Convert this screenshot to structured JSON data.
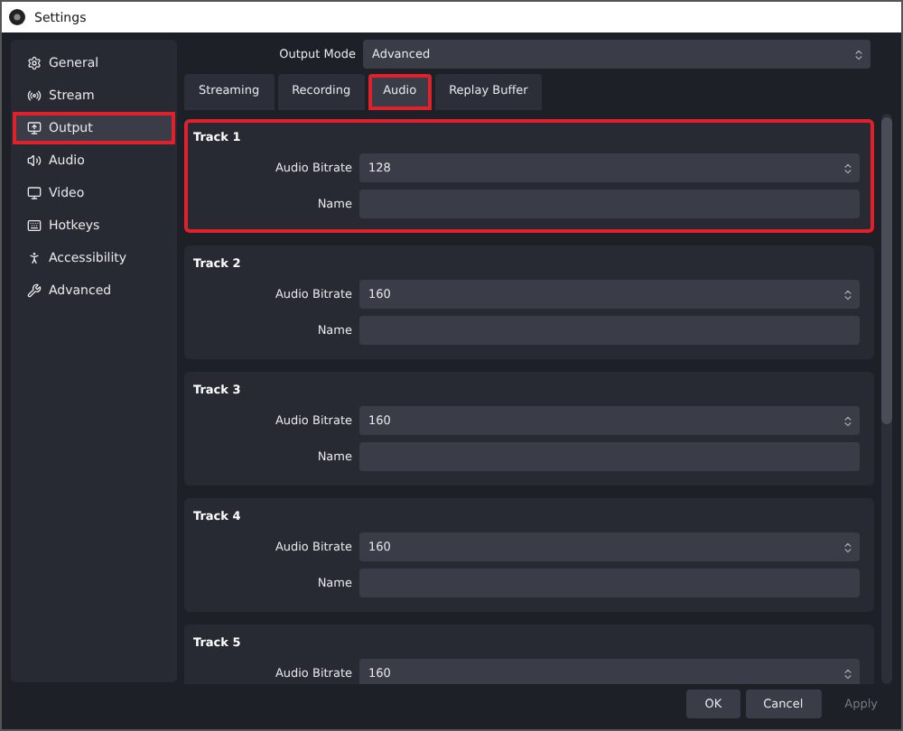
{
  "window": {
    "title": "Settings"
  },
  "sidebar": {
    "items": [
      {
        "label": "General",
        "selected": false,
        "highlighted": false
      },
      {
        "label": "Stream",
        "selected": false,
        "highlighted": false
      },
      {
        "label": "Output",
        "selected": true,
        "highlighted": true
      },
      {
        "label": "Audio",
        "selected": false,
        "highlighted": false
      },
      {
        "label": "Video",
        "selected": false,
        "highlighted": false
      },
      {
        "label": "Hotkeys",
        "selected": false,
        "highlighted": false
      },
      {
        "label": "Accessibility",
        "selected": false,
        "highlighted": false
      },
      {
        "label": "Advanced",
        "selected": false,
        "highlighted": false
      }
    ]
  },
  "output_mode": {
    "label": "Output Mode",
    "value": "Advanced"
  },
  "tabs": [
    {
      "label": "Streaming",
      "selected": false,
      "highlighted": false
    },
    {
      "label": "Recording",
      "selected": false,
      "highlighted": false
    },
    {
      "label": "Audio",
      "selected": true,
      "highlighted": true
    },
    {
      "label": "Replay Buffer",
      "selected": false,
      "highlighted": false
    }
  ],
  "tracks": [
    {
      "title": "Track 1",
      "highlighted": true,
      "bitrate_label": "Audio Bitrate",
      "bitrate": "128",
      "name_label": "Name"
    },
    {
      "title": "Track 2",
      "highlighted": false,
      "bitrate_label": "Audio Bitrate",
      "bitrate": "160",
      "name_label": "Name"
    },
    {
      "title": "Track 3",
      "highlighted": false,
      "bitrate_label": "Audio Bitrate",
      "bitrate": "160",
      "name_label": "Name"
    },
    {
      "title": "Track 4",
      "highlighted": false,
      "bitrate_label": "Audio Bitrate",
      "bitrate": "160",
      "name_label": "Name"
    },
    {
      "title": "Track 5",
      "highlighted": false,
      "bitrate_label": "Audio Bitrate",
      "bitrate": "160"
    }
  ],
  "buttons": [
    {
      "label": "OK",
      "disabled": false
    },
    {
      "label": "Cancel",
      "disabled": false
    },
    {
      "label": "Apply",
      "disabled": true
    }
  ]
}
